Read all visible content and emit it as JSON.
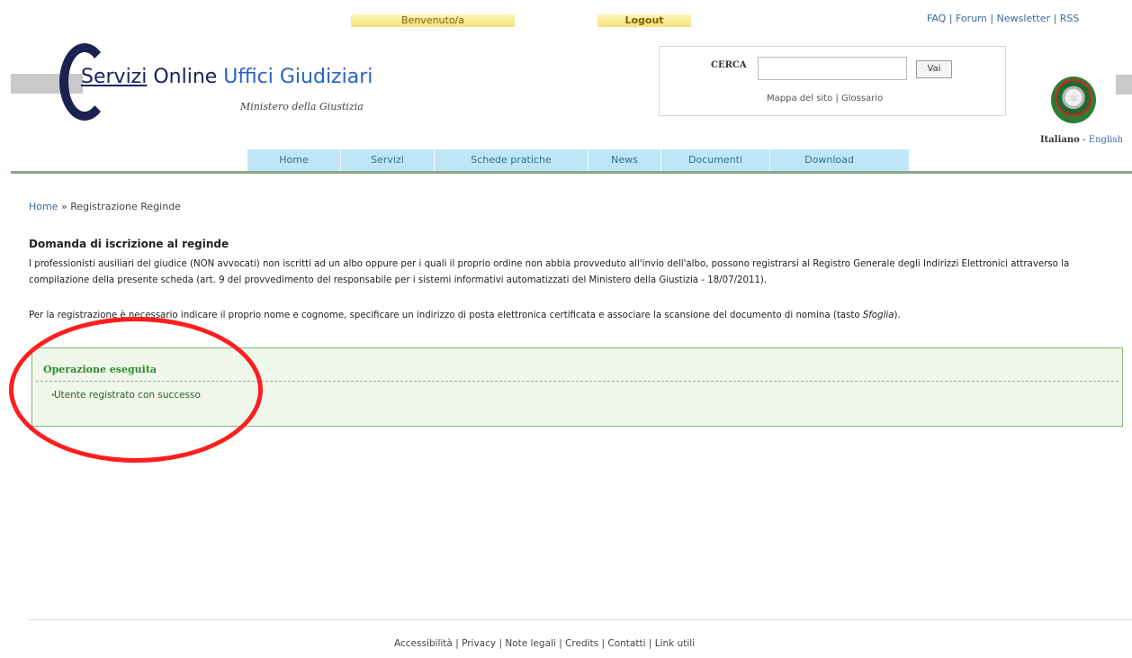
{
  "topbar": {
    "welcome": "Benvenuto/a",
    "logout": "Logout",
    "links": [
      "FAQ",
      "Forum",
      "Newsletter",
      "RSS"
    ]
  },
  "header": {
    "title_part1": "Servizi",
    "title_part2": " Online ",
    "title_part3": "Uffici Giudiziari",
    "subtitle": "Ministero della Giustizia"
  },
  "search": {
    "label": "CERCA",
    "placeholder": "",
    "button": "Vai",
    "links": [
      "Mappa del sito",
      "Glossario"
    ]
  },
  "lang": {
    "active": "Italiano",
    "other": "English"
  },
  "nav": [
    "Home",
    "Servizi",
    "Schede pratiche",
    "News",
    "Documenti",
    "Download"
  ],
  "breadcrumb": {
    "home": "Home",
    "current": "Registrazione Reginde"
  },
  "main": {
    "title": "Domanda di iscrizione al reginde",
    "para1": "I professionisti ausiliari del giudice (NON avvocati) non iscritti ad un albo oppure per i quali il proprio ordine non abbia provveduto all'invio dell'albo, possono registrarsi al Registro Generale degli Indirizzi Elettronici attraverso la compilazione della presente scheda (art. 9 del provvedimento del responsabile per i sistemi informativi automatizzati del Ministero della Giustizia - 18/07/2011).",
    "para2_prefix": "Per la registrazione è necessario indicare il proprio nome e cognome, specificare un indirizzo di posta elettronica certificata e associare la scansione del documento di nomina (tasto ",
    "para2_italic": "Sfoglia",
    "para2_suffix": ")."
  },
  "success": {
    "title": "Operazione eseguita",
    "message": "Utente registrato con successo"
  },
  "footer": {
    "links": [
      "Accessibilità",
      "Privacy",
      "Note legali",
      "Credits",
      "Contatti",
      "Link utili"
    ]
  },
  "colors": {
    "nav_bg": "#bfe6f7",
    "success_bg": "#eef7ea",
    "success_border": "#84b47a",
    "annotation_red": "#ff1d1d"
  }
}
